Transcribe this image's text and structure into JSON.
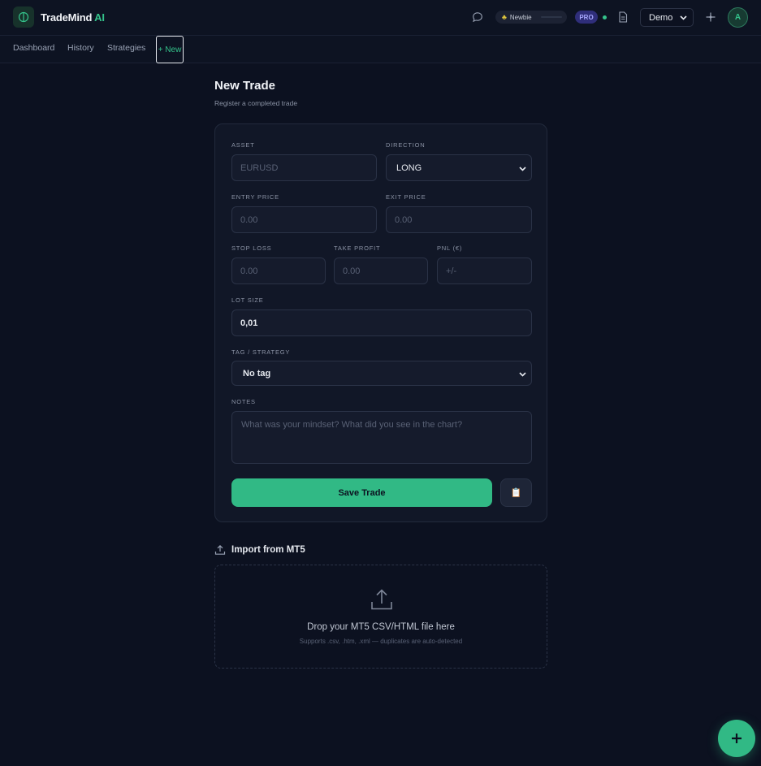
{
  "header": {
    "brand_name": "TradeMind",
    "brand_suffix": "AI",
    "level_label": "Newbie",
    "level_progress": 0,
    "plan_badge": "PRO",
    "account_select": "Demo",
    "avatar_initial": "A"
  },
  "nav": {
    "items": [
      "Dashboard",
      "History",
      "Strategies"
    ],
    "new_label": "+ New"
  },
  "page": {
    "title": "New Trade",
    "subtitle": "Register a completed trade"
  },
  "form": {
    "asset": {
      "label": "ASSET",
      "placeholder": "EURUSD"
    },
    "direction": {
      "label": "DIRECTION",
      "value": "LONG"
    },
    "entry_price": {
      "label": "ENTRY PRICE",
      "placeholder": "0.00"
    },
    "exit_price": {
      "label": "EXIT PRICE",
      "placeholder": "0.00"
    },
    "stop_loss": {
      "label": "STOP LOSS",
      "placeholder": "0.00"
    },
    "take_profit": {
      "label": "TAKE PROFIT",
      "placeholder": "0.00"
    },
    "pnl": {
      "label": "PNL (€)",
      "placeholder": "+/-"
    },
    "lot_size": {
      "label": "LOT SIZE",
      "value": "0,01"
    },
    "tag": {
      "label": "TAG / STRATEGY",
      "value": "No tag"
    },
    "notes": {
      "label": "NOTES",
      "placeholder": "What was your mindset? What did you see in the chart?"
    },
    "save_label": "Save Trade",
    "clipboard_icon": "📋"
  },
  "import": {
    "title": "Import from MT5",
    "drop_title": "Drop your MT5 CSV/HTML file here",
    "drop_subtitle": "Supports .csv, .htm, .xml — duplicates are auto-detected"
  },
  "colors": {
    "accent": "#31b985",
    "background": "#0c1120",
    "card": "#111727",
    "pro": "#2f2e7a"
  }
}
